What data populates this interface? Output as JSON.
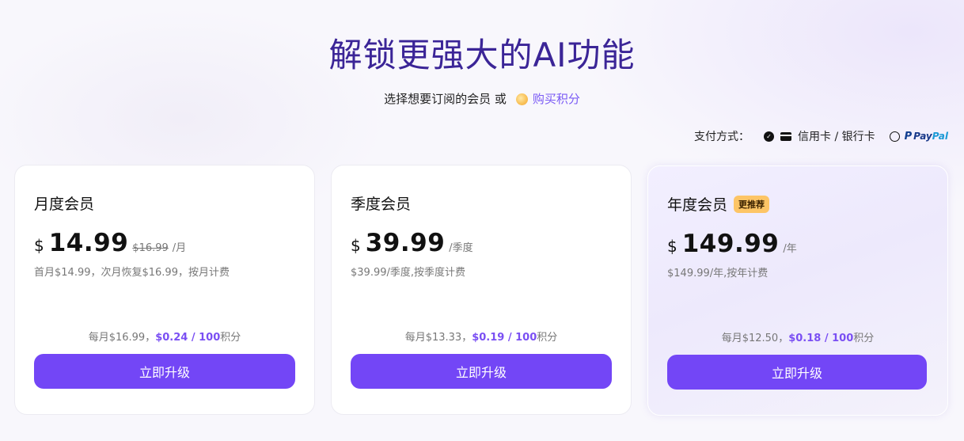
{
  "header": {
    "title": "解锁更强大的AI功能",
    "subtitle_text": "选择想要订阅的会员 或",
    "buy_points_link": "购买积分"
  },
  "payment": {
    "label": "支付方式：",
    "option_card": "信用卡 / 银行卡",
    "option_paypal_pay": "Pay",
    "option_paypal_pal": "Pal",
    "selected": "card"
  },
  "plans": [
    {
      "name": "月度会员",
      "currency": "$",
      "amount": "14.99",
      "original": "$16.99",
      "period": "/月",
      "description": "首月$14.99，次月恢复$16.99，按月计费",
      "perks_prefix": "每月$16.99，",
      "perks_highlight": "$0.24 / 100",
      "perks_suffix": "积分",
      "button": "立即升级"
    },
    {
      "name": "季度会员",
      "currency": "$",
      "amount": "39.99",
      "period": "/季度",
      "description": "$39.99/季度,按季度计费",
      "perks_prefix": "每月$13.33，",
      "perks_highlight": "$0.19 / 100",
      "perks_suffix": "积分",
      "button": "立即升级"
    },
    {
      "name": "年度会员",
      "badge": "更推荐",
      "currency": "$",
      "amount": "149.99",
      "period": "/年",
      "description": "$149.99/年,按年计费",
      "perks_prefix": "每月$12.50，",
      "perks_highlight": "$0.18 / 100",
      "perks_suffix": "积分",
      "button": "立即升级"
    }
  ],
  "colors": {
    "title": "#3b2597",
    "accent": "#7346f6",
    "highlight": "#7a4ff3",
    "badge": "#fdc566"
  }
}
